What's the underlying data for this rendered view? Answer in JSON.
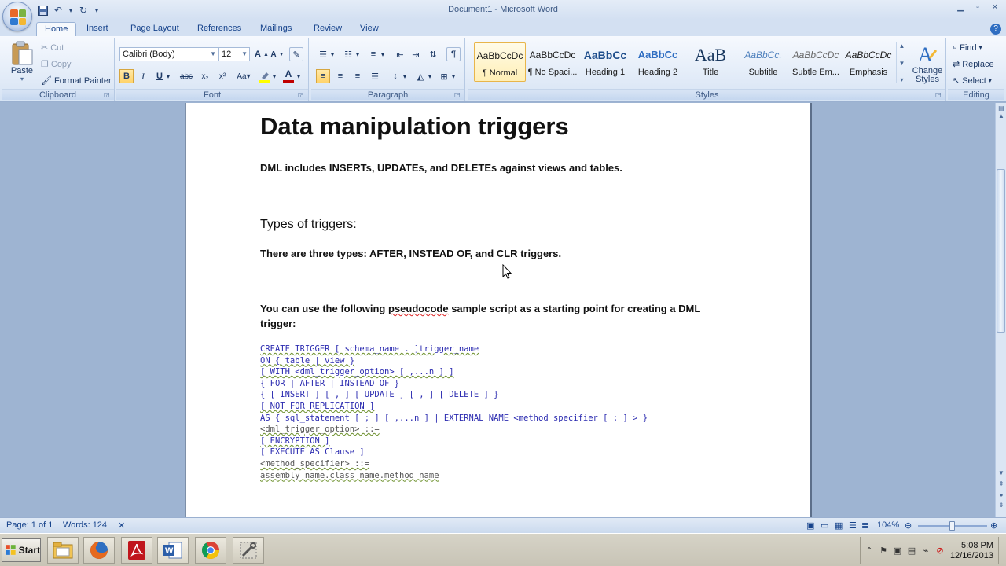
{
  "window": {
    "title": "Document1 - Microsoft Word"
  },
  "tabs": [
    "Home",
    "Insert",
    "Page Layout",
    "References",
    "Mailings",
    "Review",
    "View"
  ],
  "ribbon": {
    "clipboard": {
      "label": "Clipboard",
      "paste": "Paste",
      "cut": "Cut",
      "copy": "Copy",
      "format_painter": "Format Painter"
    },
    "font": {
      "label": "Font",
      "face": "Calibri (Body)",
      "size": "12"
    },
    "paragraph": {
      "label": "Paragraph"
    },
    "styles": {
      "label": "Styles",
      "items": [
        {
          "sample": "AaBbCcDc",
          "name": "¶ Normal"
        },
        {
          "sample": "AaBbCcDc",
          "name": "¶ No Spaci..."
        },
        {
          "sample": "AaBbCc",
          "name": "Heading 1"
        },
        {
          "sample": "AaBbCc",
          "name": "Heading 2"
        },
        {
          "sample": "AaB",
          "name": "Title"
        },
        {
          "sample": "AaBbCc.",
          "name": "Subtitle"
        },
        {
          "sample": "AaBbCcDc",
          "name": "Subtle Em..."
        },
        {
          "sample": "AaBbCcDc",
          "name": "Emphasis"
        }
      ],
      "change_styles": "Change Styles"
    },
    "editing": {
      "label": "Editing",
      "find": "Find",
      "replace": "Replace",
      "select": "Select"
    }
  },
  "document": {
    "heading": "Data manipulation triggers",
    "p1": "DML includes INSERTs, UPDATEs, and DELETEs against views and tables.",
    "h2": "Types of triggers:",
    "p2": "There are three types: AFTER, INSTEAD OF, and CLR triggers.",
    "p3_line1_a": "You can use the following ",
    "p3_line1_b": "pseudocode",
    "p3_line1_c": " sample script as a starting point for creating a DML",
    "p3_line2": "trigger:",
    "code": [
      "CREATE TRIGGER [ schema_name . ]trigger_name",
      "ON { table | view }",
      "[ WITH <dml_trigger_option> [ ,...n ] ]",
      "{ FOR | AFTER | INSTEAD OF }",
      "{ [ INSERT ] [ , ] [ UPDATE ] [ , ] [ DELETE ] }",
      "[ NOT FOR REPLICATION ]",
      "AS { sql_statement [ ; ] [ ,...n ] | EXTERNAL NAME <method specifier [ ; ] > }",
      "<dml_trigger_option> ::=",
      "[ ENCRYPTION ]",
      "[ EXECUTE AS Clause ]",
      "<method_specifier> ::=",
      "assembly_name.class_name.method_name"
    ]
  },
  "status": {
    "page": "Page: 1 of 1",
    "words": "Words: 124",
    "zoom": "104%"
  },
  "taskbar": {
    "start": "Start",
    "time": "5:08 PM",
    "date": "12/16/2013"
  }
}
